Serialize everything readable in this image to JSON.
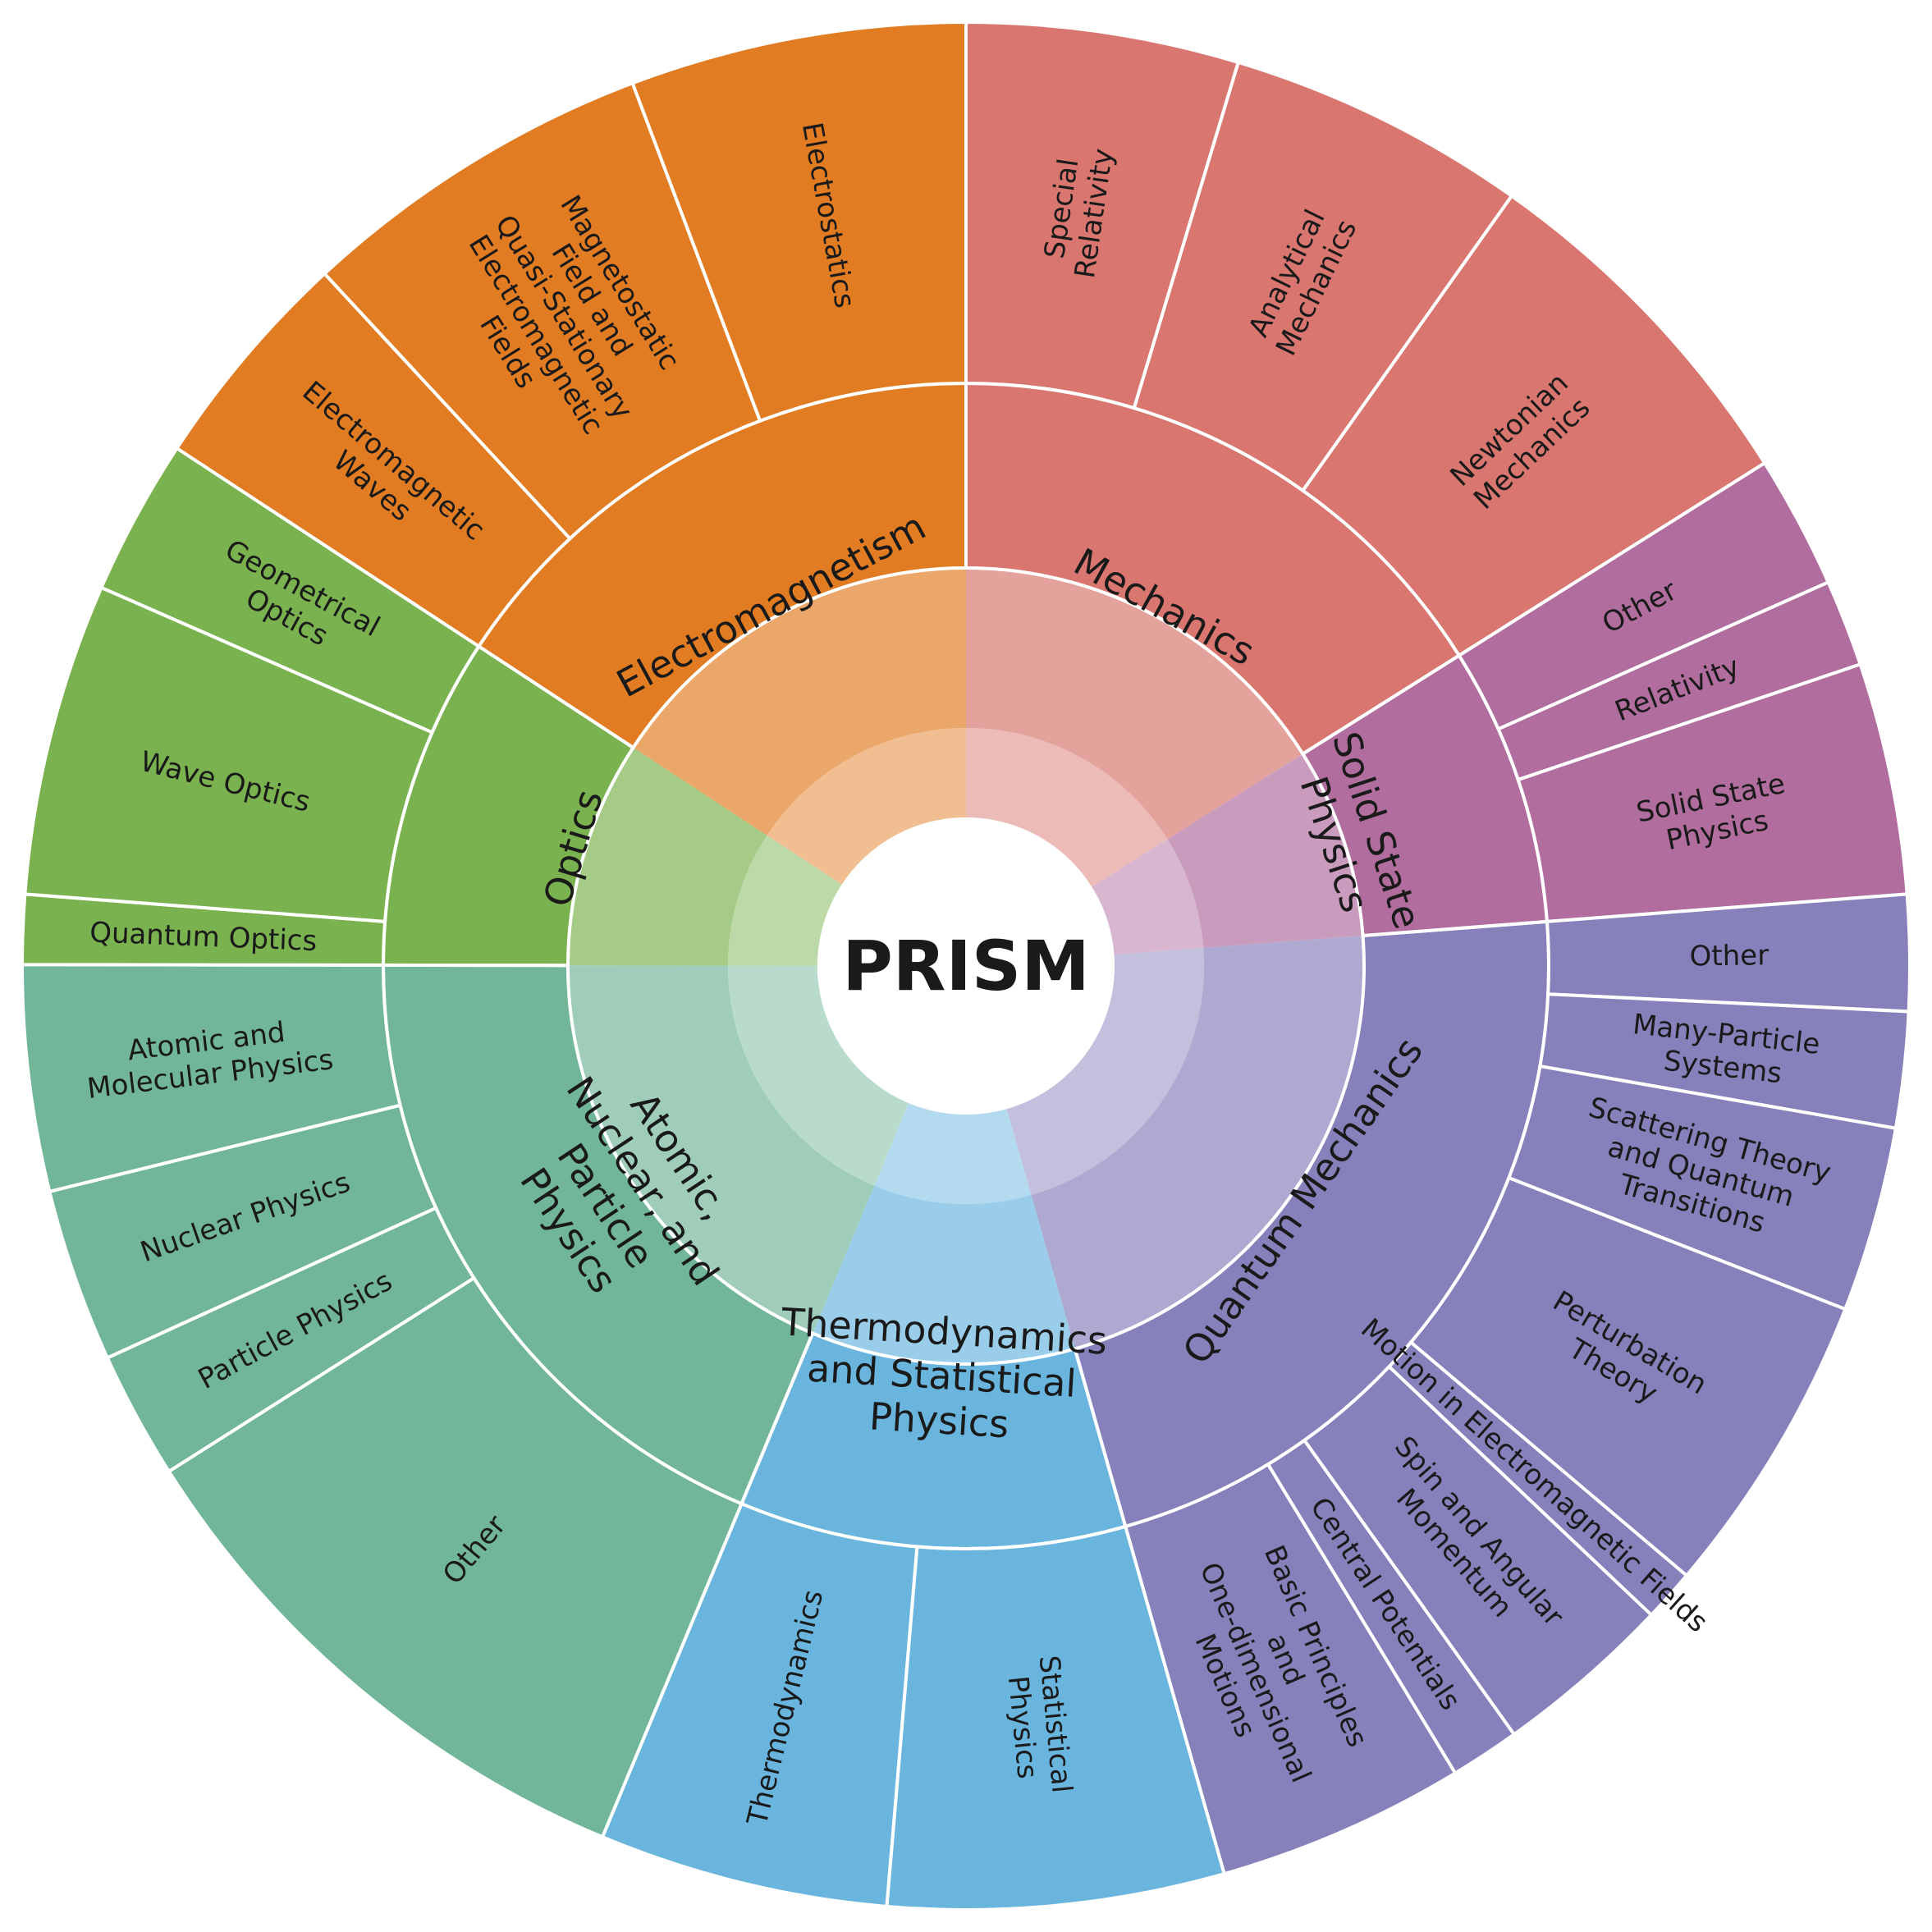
{
  "chart_data": {
    "type": "sunburst",
    "center_label": "PRISM",
    "categories": [
      {
        "name": "Mechanics",
        "color": "#D8766F",
        "sub": [
          {
            "name": "Special Relativity",
            "size": 47
          },
          {
            "name": "Analytical Mechanics",
            "size": 52
          },
          {
            "name": "Newtonian Mechanics",
            "size": 63
          }
        ]
      },
      {
        "name": "Solid State Physics",
        "color": "#B06D9E",
        "sub": [
          {
            "name": "Other",
            "size": 23
          },
          {
            "name": "Relativity",
            "size": 15
          },
          {
            "name": "Solid State Physics",
            "size": 40
          }
        ]
      },
      {
        "name": "Quantum Mechanics",
        "color": "#8681BB",
        "sub": [
          {
            "name": "Other",
            "size": 20
          },
          {
            "name": "Many-Particle Systems",
            "size": 20
          },
          {
            "name": "Scattering Theory and Quantum Transitions",
            "size": 32
          },
          {
            "name": "Perturbation Theory",
            "size": 53
          },
          {
            "name": "Motion in Electromagnetic Fields",
            "size": 9
          },
          {
            "name": "Spin and Angular Momentum",
            "size": 31
          },
          {
            "name": "Central Potentials",
            "size": 12
          },
          {
            "name": "Basic Principles and One-dimensional Motions",
            "size": 43
          }
        ]
      },
      {
        "name": "Thermodynamics and Statistical Physics",
        "color": "#69B5DE",
        "sub": [
          {
            "name": "Statistical Physics",
            "size": 58
          },
          {
            "name": "Thermodynamics",
            "size": 50
          }
        ]
      },
      {
        "name": "Atomic, Nuclear, and Particle Physics",
        "color": "#72B699",
        "sub": [
          {
            "name": "Other",
            "size": 98
          },
          {
            "name": "Particle Physics",
            "size": 22
          },
          {
            "name": "Nuclear Physics",
            "size": 30
          },
          {
            "name": "Atomic and Molecular Physics",
            "size": 39
          }
        ]
      },
      {
        "name": "Optics",
        "color": "#7AB24F",
        "sub": [
          {
            "name": "Quantum Optics",
            "size": 12
          },
          {
            "name": "Wave Optics",
            "size": 54
          },
          {
            "name": "Geometrical Optics",
            "size": 27
          }
        ]
      },
      {
        "name": "Electromagnetism",
        "color": "#E27C22",
        "sub": [
          {
            "name": "Electromagnetic Waves",
            "size": 39
          },
          {
            "name": "Magnetostatic Field and Quasi-Stationary Electromagnetic Fields",
            "size": 62
          },
          {
            "name": "Electrostatics",
            "size": 58
          }
        ]
      }
    ]
  }
}
